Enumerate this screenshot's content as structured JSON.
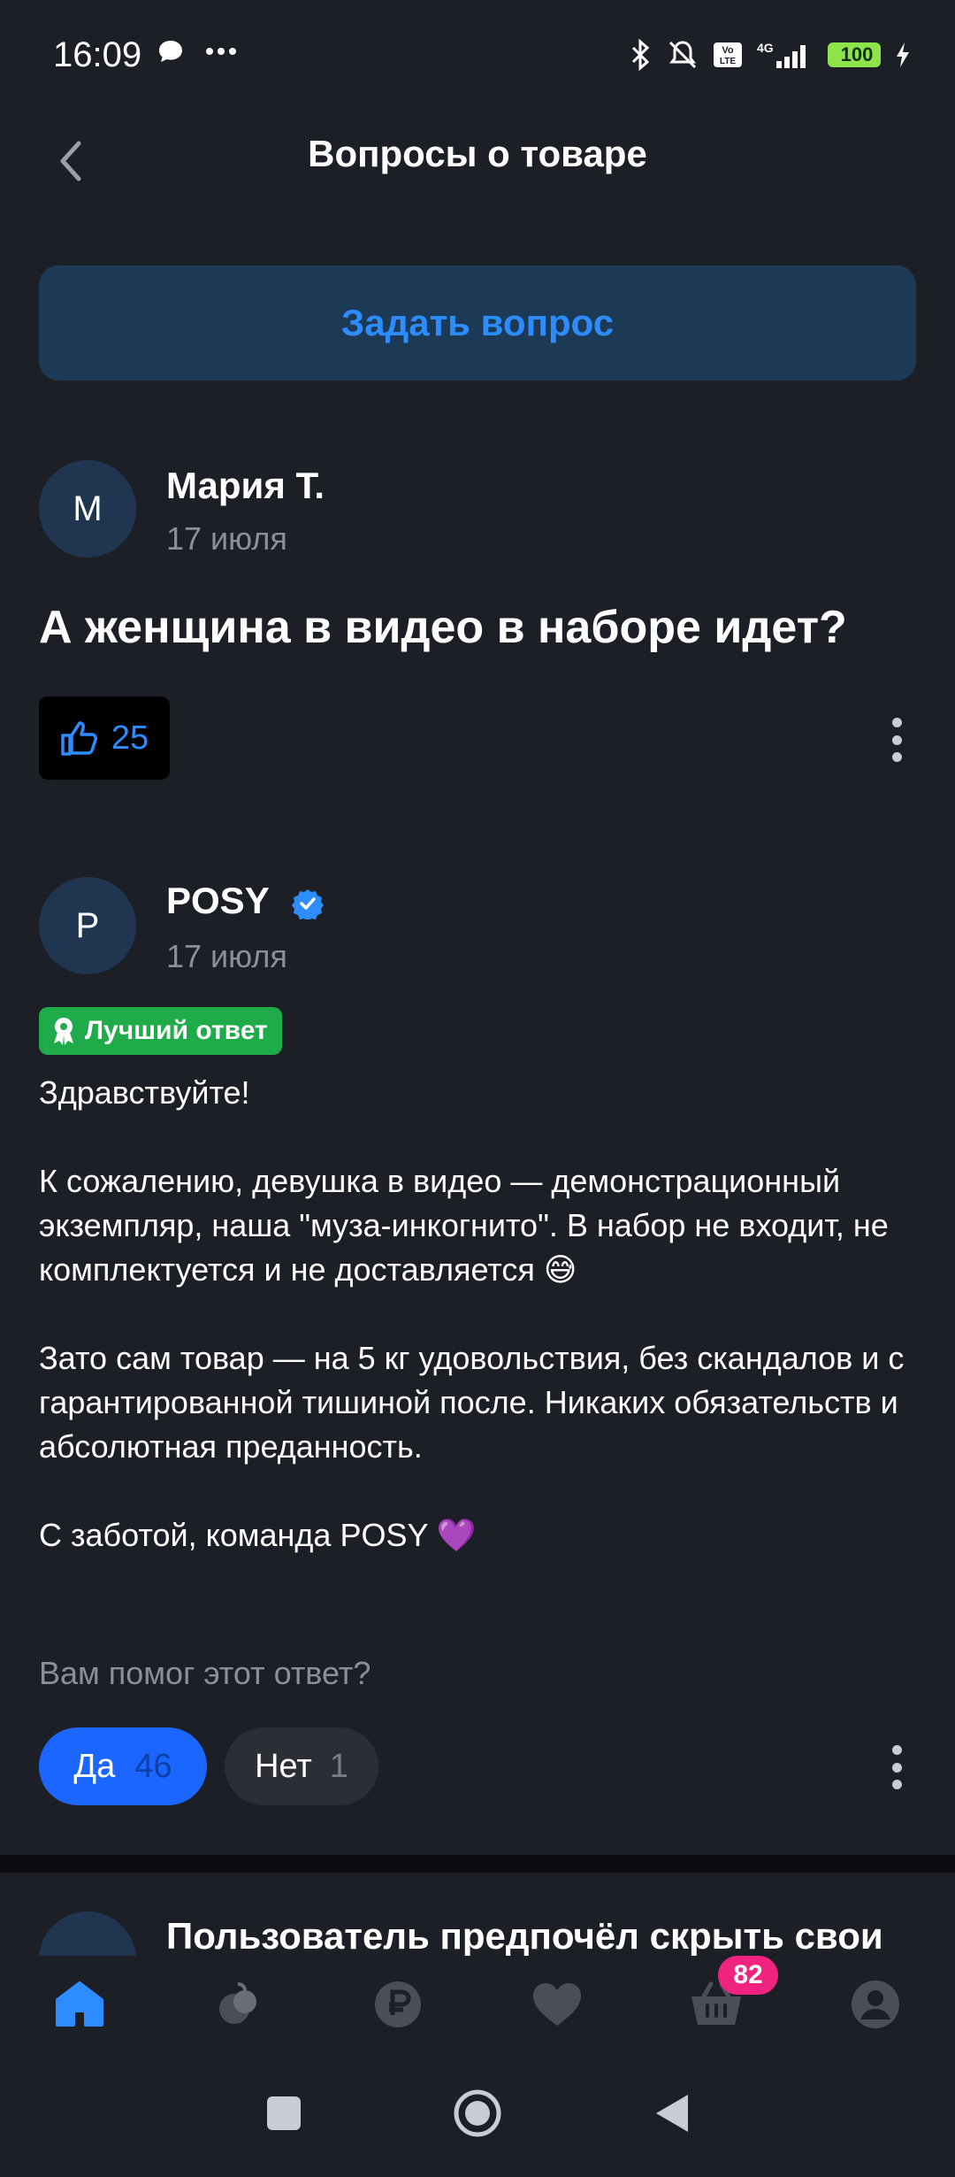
{
  "status": {
    "time": "16:09",
    "battery": "100",
    "network": "4G"
  },
  "header": {
    "title": "Вопросы о товаре"
  },
  "ask_button": {
    "label": "Задать вопрос"
  },
  "question": {
    "avatar_letter": "М",
    "author": "Мария Т.",
    "date": "17 июля",
    "text": "А женщина в видео в наборе идет?",
    "likes": "25"
  },
  "answer": {
    "avatar_letter": "P",
    "author": "POSY",
    "date": "17 июля",
    "badge": "Лучший ответ",
    "paragraphs": [
      "Здравствуйте!",
      "К сожалению, девушка в видео — демонстрационный экземпляр, наша \"муза-инкогнито\". В набор не входит, не комплектуется и не доставляется 😅",
      "Зато сам товар — на 5 кг удовольствия, без скандалов и с гарантированной тишиной после. Никаких обязательств и абсолютная преданность.",
      "С заботой, команда POSY 💜"
    ],
    "helpful_question": "Вам помог этот ответ?",
    "yes_label": "Да",
    "yes_count": "46",
    "no_label": "Нет",
    "no_count": "1"
  },
  "next_item": {
    "text": "Пользователь предпочёл скрыть свои"
  },
  "bottom_nav": {
    "items": [
      "home-icon",
      "catalog-icon",
      "payments-icon",
      "favorites-icon",
      "cart-icon",
      "profile-icon"
    ],
    "cart_badge": "82"
  },
  "colors": {
    "accent": "#1a66ff",
    "link": "#2d8cff",
    "best": "#1fab4a",
    "badge": "#f0237f",
    "bg": "#1c1f26"
  }
}
